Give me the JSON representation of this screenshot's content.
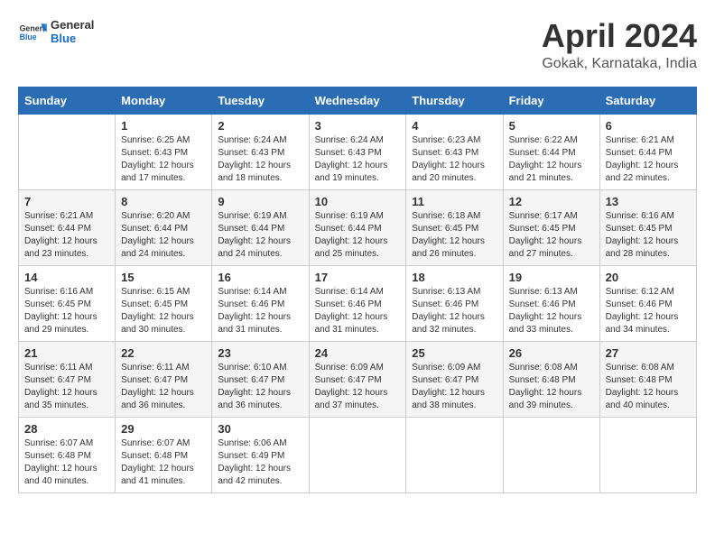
{
  "header": {
    "logo_general": "General",
    "logo_blue": "Blue",
    "month_year": "April 2024",
    "location": "Gokak, Karnataka, India"
  },
  "days_of_week": [
    "Sunday",
    "Monday",
    "Tuesday",
    "Wednesday",
    "Thursday",
    "Friday",
    "Saturday"
  ],
  "weeks": [
    [
      {
        "num": "",
        "info": ""
      },
      {
        "num": "1",
        "info": "Sunrise: 6:25 AM\nSunset: 6:43 PM\nDaylight: 12 hours\nand 17 minutes."
      },
      {
        "num": "2",
        "info": "Sunrise: 6:24 AM\nSunset: 6:43 PM\nDaylight: 12 hours\nand 18 minutes."
      },
      {
        "num": "3",
        "info": "Sunrise: 6:24 AM\nSunset: 6:43 PM\nDaylight: 12 hours\nand 19 minutes."
      },
      {
        "num": "4",
        "info": "Sunrise: 6:23 AM\nSunset: 6:43 PM\nDaylight: 12 hours\nand 20 minutes."
      },
      {
        "num": "5",
        "info": "Sunrise: 6:22 AM\nSunset: 6:44 PM\nDaylight: 12 hours\nand 21 minutes."
      },
      {
        "num": "6",
        "info": "Sunrise: 6:21 AM\nSunset: 6:44 PM\nDaylight: 12 hours\nand 22 minutes."
      }
    ],
    [
      {
        "num": "7",
        "info": "Sunrise: 6:21 AM\nSunset: 6:44 PM\nDaylight: 12 hours\nand 23 minutes."
      },
      {
        "num": "8",
        "info": "Sunrise: 6:20 AM\nSunset: 6:44 PM\nDaylight: 12 hours\nand 24 minutes."
      },
      {
        "num": "9",
        "info": "Sunrise: 6:19 AM\nSunset: 6:44 PM\nDaylight: 12 hours\nand 24 minutes."
      },
      {
        "num": "10",
        "info": "Sunrise: 6:19 AM\nSunset: 6:44 PM\nDaylight: 12 hours\nand 25 minutes."
      },
      {
        "num": "11",
        "info": "Sunrise: 6:18 AM\nSunset: 6:45 PM\nDaylight: 12 hours\nand 26 minutes."
      },
      {
        "num": "12",
        "info": "Sunrise: 6:17 AM\nSunset: 6:45 PM\nDaylight: 12 hours\nand 27 minutes."
      },
      {
        "num": "13",
        "info": "Sunrise: 6:16 AM\nSunset: 6:45 PM\nDaylight: 12 hours\nand 28 minutes."
      }
    ],
    [
      {
        "num": "14",
        "info": "Sunrise: 6:16 AM\nSunset: 6:45 PM\nDaylight: 12 hours\nand 29 minutes."
      },
      {
        "num": "15",
        "info": "Sunrise: 6:15 AM\nSunset: 6:45 PM\nDaylight: 12 hours\nand 30 minutes."
      },
      {
        "num": "16",
        "info": "Sunrise: 6:14 AM\nSunset: 6:46 PM\nDaylight: 12 hours\nand 31 minutes."
      },
      {
        "num": "17",
        "info": "Sunrise: 6:14 AM\nSunset: 6:46 PM\nDaylight: 12 hours\nand 31 minutes."
      },
      {
        "num": "18",
        "info": "Sunrise: 6:13 AM\nSunset: 6:46 PM\nDaylight: 12 hours\nand 32 minutes."
      },
      {
        "num": "19",
        "info": "Sunrise: 6:13 AM\nSunset: 6:46 PM\nDaylight: 12 hours\nand 33 minutes."
      },
      {
        "num": "20",
        "info": "Sunrise: 6:12 AM\nSunset: 6:46 PM\nDaylight: 12 hours\nand 34 minutes."
      }
    ],
    [
      {
        "num": "21",
        "info": "Sunrise: 6:11 AM\nSunset: 6:47 PM\nDaylight: 12 hours\nand 35 minutes."
      },
      {
        "num": "22",
        "info": "Sunrise: 6:11 AM\nSunset: 6:47 PM\nDaylight: 12 hours\nand 36 minutes."
      },
      {
        "num": "23",
        "info": "Sunrise: 6:10 AM\nSunset: 6:47 PM\nDaylight: 12 hours\nand 36 minutes."
      },
      {
        "num": "24",
        "info": "Sunrise: 6:09 AM\nSunset: 6:47 PM\nDaylight: 12 hours\nand 37 minutes."
      },
      {
        "num": "25",
        "info": "Sunrise: 6:09 AM\nSunset: 6:47 PM\nDaylight: 12 hours\nand 38 minutes."
      },
      {
        "num": "26",
        "info": "Sunrise: 6:08 AM\nSunset: 6:48 PM\nDaylight: 12 hours\nand 39 minutes."
      },
      {
        "num": "27",
        "info": "Sunrise: 6:08 AM\nSunset: 6:48 PM\nDaylight: 12 hours\nand 40 minutes."
      }
    ],
    [
      {
        "num": "28",
        "info": "Sunrise: 6:07 AM\nSunset: 6:48 PM\nDaylight: 12 hours\nand 40 minutes."
      },
      {
        "num": "29",
        "info": "Sunrise: 6:07 AM\nSunset: 6:48 PM\nDaylight: 12 hours\nand 41 minutes."
      },
      {
        "num": "30",
        "info": "Sunrise: 6:06 AM\nSunset: 6:49 PM\nDaylight: 12 hours\nand 42 minutes."
      },
      {
        "num": "",
        "info": ""
      },
      {
        "num": "",
        "info": ""
      },
      {
        "num": "",
        "info": ""
      },
      {
        "num": "",
        "info": ""
      }
    ]
  ]
}
